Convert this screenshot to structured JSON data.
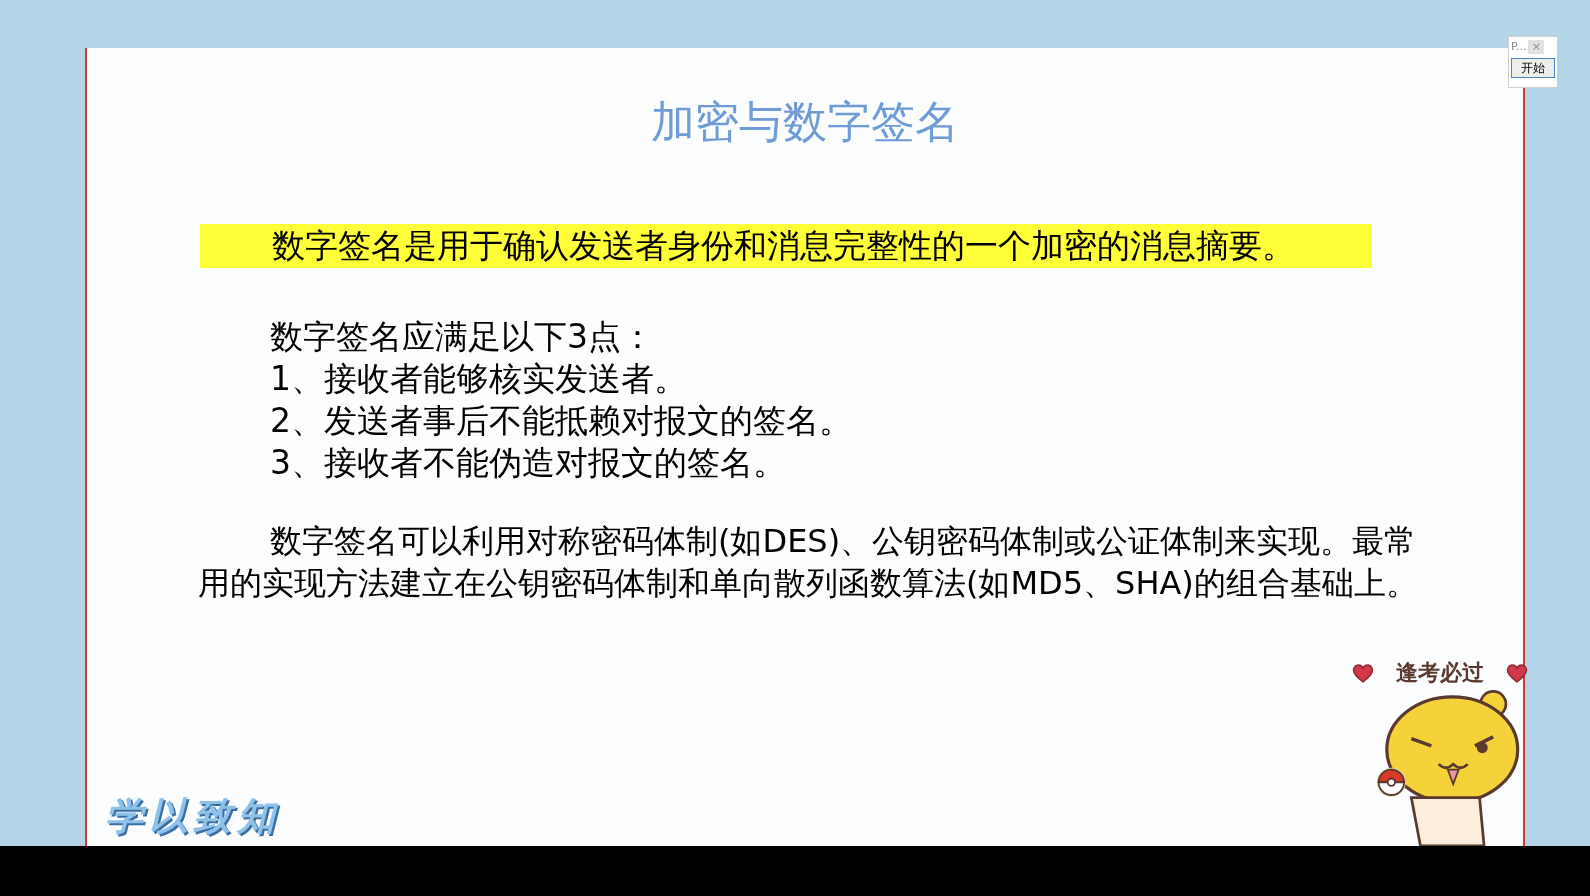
{
  "slide": {
    "title": "加密与数字签名",
    "definition": "数字签名是用于确认发送者身份和消息完整性的一个加密的消息摘要。",
    "requirements_heading": "数字签名应满足以下3点：",
    "requirements": [
      "1、接收者能够核实发送者。",
      "2、发送者事后不能抵赖对报文的签名。",
      "3、接收者不能伪造对报文的签名。"
    ],
    "implementation": "数字签名可以利用对称密码体制(如DES)、公钥密码体制或公证体制来实现。最常用的实现方法建立在公钥密码体制和单向散列函数算法(如MD5、SHA)的组合基础上。",
    "logo_text": "学以致知",
    "sticker_caption": "逢考必过"
  },
  "presenter_panel": {
    "title": "P...",
    "close": "×",
    "button": "开始"
  }
}
